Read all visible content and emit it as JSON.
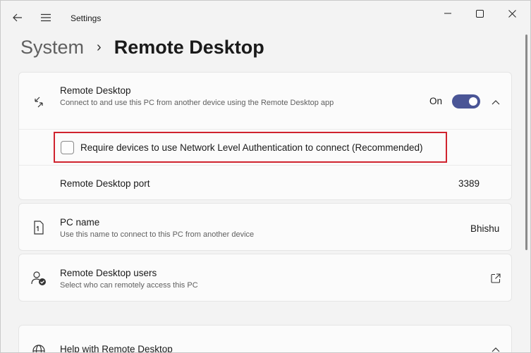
{
  "titlebar": {
    "app_title": "Settings",
    "icons": [
      "back-arrow-icon",
      "hamburger-menu-icon",
      "minimize-icon",
      "maximize-icon",
      "close-icon"
    ]
  },
  "breadcrumb": {
    "parent": "System",
    "separator": "›",
    "current": "Remote Desktop"
  },
  "remote_desktop": {
    "title": "Remote Desktop",
    "description": "Connect to and use this PC from another device using the Remote Desktop app",
    "toggle_state_label": "On",
    "toggle_on": true,
    "nla_label": "Require devices to use Network Level Authentication to connect (Recommended)",
    "nla_checked": false,
    "port_label": "Remote Desktop port",
    "port_value": "3389"
  },
  "pc_name": {
    "title": "PC name",
    "description": "Use this name to connect to this PC from another device",
    "value": "Bhishu"
  },
  "rd_users": {
    "title": "Remote Desktop users",
    "description": "Select who can remotely access this PC"
  },
  "help": {
    "title": "Help with Remote Desktop"
  },
  "colors": {
    "accent": "#4a5596",
    "highlight_border": "#d0232e",
    "background": "#f3f3f3",
    "card": "#fbfbfb"
  }
}
